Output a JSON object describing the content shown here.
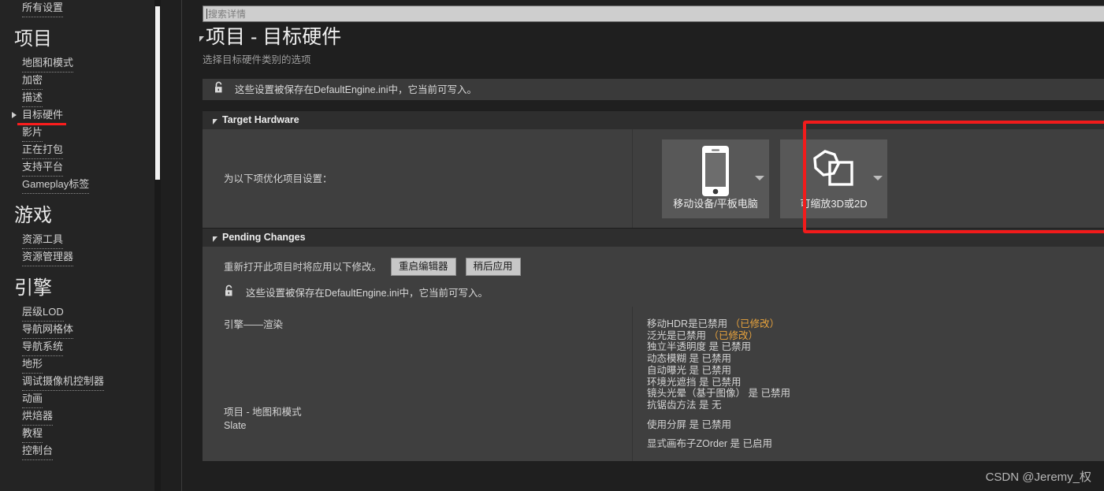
{
  "sidebar": {
    "all_settings": "所有设置",
    "groups": [
      {
        "title": "项目",
        "items": [
          {
            "label": "地图和模式",
            "expandable": false,
            "selected": false
          },
          {
            "label": "加密",
            "expandable": false,
            "selected": false
          },
          {
            "label": "描述",
            "expandable": false,
            "selected": false
          },
          {
            "label": "目标硬件",
            "expandable": true,
            "selected": true
          },
          {
            "label": "影片",
            "expandable": false,
            "selected": false
          },
          {
            "label": "正在打包",
            "expandable": false,
            "selected": false
          },
          {
            "label": "支持平台",
            "expandable": false,
            "selected": false
          },
          {
            "label": "Gameplay标签",
            "expandable": false,
            "selected": false
          }
        ]
      },
      {
        "title": "游戏",
        "items": [
          {
            "label": "资源工具",
            "expandable": false,
            "selected": false
          },
          {
            "label": "资源管理器",
            "expandable": false,
            "selected": false
          }
        ]
      },
      {
        "title": "引擎",
        "items": [
          {
            "label": "层级LOD",
            "expandable": false,
            "selected": false
          },
          {
            "label": "导航网格体",
            "expandable": false,
            "selected": false
          },
          {
            "label": "导航系统",
            "expandable": false,
            "selected": false
          },
          {
            "label": "地形",
            "expandable": false,
            "selected": false
          },
          {
            "label": "调试摄像机控制器",
            "expandable": false,
            "selected": false
          },
          {
            "label": "动画",
            "expandable": false,
            "selected": false
          },
          {
            "label": "烘焙器",
            "expandable": false,
            "selected": false
          },
          {
            "label": "教程",
            "expandable": false,
            "selected": false
          },
          {
            "label": "控制台",
            "expandable": false,
            "selected": false
          }
        ]
      }
    ]
  },
  "search": {
    "placeholder": "搜索详情",
    "value": ""
  },
  "page": {
    "title": "项目 - 目标硬件",
    "subtitle": "选择目标硬件类别的选项",
    "ini_notice": "这些设置被保存在DefaultEngine.ini中，它当前可写入。"
  },
  "target_hardware": {
    "section_title": "Target Hardware",
    "row_label": "为以下项优化项目设置：",
    "cards": [
      {
        "name": "移动设备/平板电脑",
        "icon": "mobile-tablet-icon"
      },
      {
        "name": "可缩放3D或2D",
        "icon": "scalable-3d-2d-icon"
      }
    ]
  },
  "pending_changes": {
    "section_title": "Pending Changes",
    "notice": "重新打开此项目时将应用以下修改。",
    "restart_button": "重启编辑器",
    "apply_later_button": "稍后应用",
    "ini_notice": "这些设置被保存在DefaultEngine.ini中，它当前可写入。",
    "groups": [
      {
        "label": "引擎——渲染",
        "items": [
          {
            "text": "移动HDR是已禁用",
            "modified": "（已修改）"
          },
          {
            "text": "泛光是已禁用",
            "modified": "（已修改）"
          },
          {
            "text": "独立半透明度 是 已禁用",
            "modified": ""
          },
          {
            "text": "动态模糊 是 已禁用",
            "modified": ""
          },
          {
            "text": "自动曝光 是 已禁用",
            "modified": ""
          },
          {
            "text": "环境光遮挡 是 已禁用",
            "modified": ""
          },
          {
            "text": "镜头光晕（基于图像） 是 已禁用",
            "modified": ""
          },
          {
            "text": "抗锯齿方法 是 无",
            "modified": ""
          }
        ]
      },
      {
        "label": "项目 - 地图和模式",
        "items": [
          {
            "text": "使用分屏 是 已禁用",
            "modified": ""
          }
        ]
      },
      {
        "label": "Slate",
        "items": [
          {
            "text": "显式画布子ZOrder 是 已启用",
            "modified": ""
          }
        ]
      }
    ]
  },
  "watermark": "CSDN @Jeremy_权",
  "colors": {
    "highlight_red": "#f21b1b",
    "modified_orange": "#e8a33d",
    "panel_bg": "#3f3f3f",
    "section_header_bg": "#2e2e2e",
    "app_bg": "#1f1f1f"
  }
}
